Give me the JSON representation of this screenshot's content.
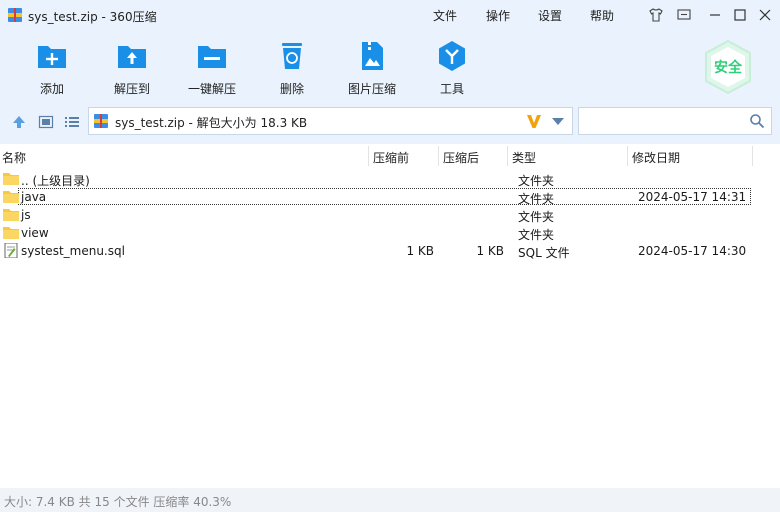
{
  "window": {
    "title": "sys_test.zip - 360压缩"
  },
  "menu": {
    "file": "文件",
    "operate": "操作",
    "settings": "设置",
    "help": "帮助"
  },
  "toolbar": {
    "add": "添加",
    "extract_to": "解压到",
    "one_click_extract": "一键解压",
    "delete": "删除",
    "image_compress": "图片压缩",
    "tools": "工具",
    "security_badge": "安全"
  },
  "address": {
    "text": "sys_test.zip - 解包大小为 18.3 KB"
  },
  "search": {
    "value": "",
    "placeholder": ""
  },
  "columns": {
    "name": "名称",
    "before": "压缩前",
    "after": "压缩后",
    "type": "类型",
    "modified": "修改日期"
  },
  "files": [
    {
      "name": ".. (上级目录)",
      "before": "",
      "after": "",
      "type": "文件夹",
      "date": ""
    },
    {
      "name": "java",
      "before": "",
      "after": "",
      "type": "文件夹",
      "date": "2024-05-17 14:31"
    },
    {
      "name": "js",
      "before": "",
      "after": "",
      "type": "文件夹",
      "date": ""
    },
    {
      "name": "view",
      "before": "",
      "after": "",
      "type": "文件夹",
      "date": ""
    },
    {
      "name": "systest_menu.sql",
      "before": "1 KB",
      "after": "1 KB",
      "type": "SQL 文件",
      "date": "2024-05-17 14:30"
    }
  ],
  "status": {
    "text": "大小: 7.4 KB 共 15 个文件 压缩率 40.3%"
  },
  "colors": {
    "chrome": "#eaf3fd",
    "accent": "#1a8fe8",
    "folder": "#f7c843",
    "badge": "#2fcf7a"
  }
}
